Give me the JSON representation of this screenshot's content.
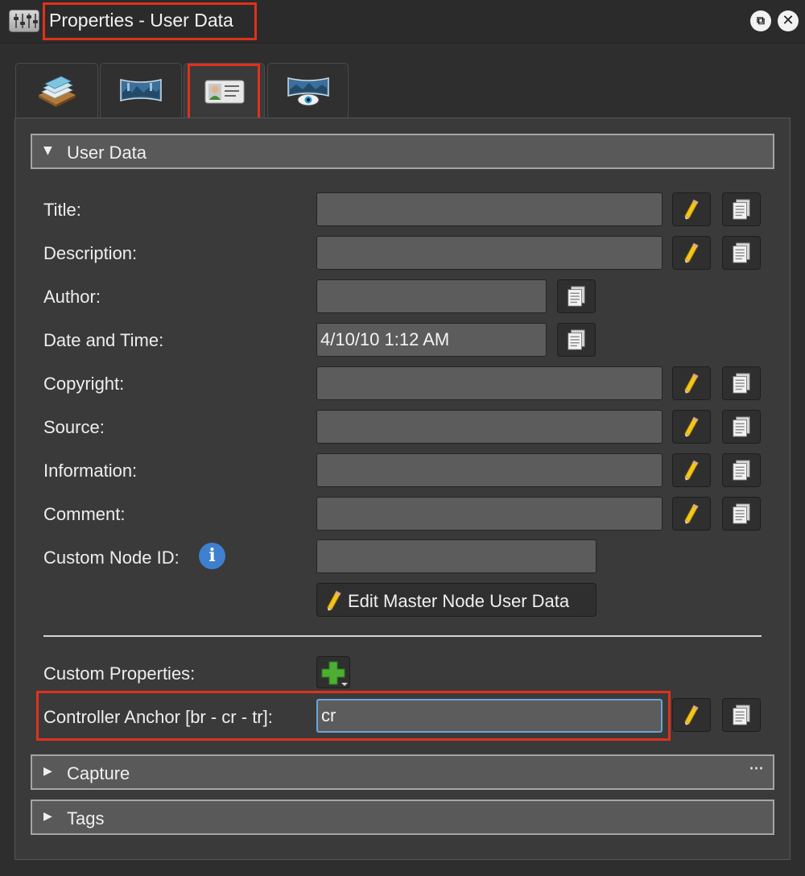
{
  "window": {
    "title": "Properties - User Data",
    "restore_icon": "restore-icon",
    "close_icon": "close-icon"
  },
  "tabs": [
    {
      "name": "layers-tab",
      "icon": "stacked-layers-icon",
      "active": false
    },
    {
      "name": "panorama-tab",
      "icon": "panorama-icon",
      "active": false
    },
    {
      "name": "user-data-tab",
      "icon": "id-card-icon",
      "active": true
    },
    {
      "name": "viewer-tab",
      "icon": "panorama-eye-icon",
      "active": false
    }
  ],
  "user_data": {
    "header": "User Data",
    "expanded": true,
    "fields": {
      "title": {
        "label": "Title:",
        "value": ""
      },
      "description": {
        "label": "Description:",
        "value": ""
      },
      "author": {
        "label": "Author:",
        "value": ""
      },
      "datetime": {
        "label": "Date and Time:",
        "value": "4/10/10 1:12 AM"
      },
      "copyright": {
        "label": "Copyright:",
        "value": ""
      },
      "source": {
        "label": "Source:",
        "value": ""
      },
      "information": {
        "label": "Information:",
        "value": ""
      },
      "comment": {
        "label": "Comment:",
        "value": ""
      },
      "custom_node_id": {
        "label": "Custom Node ID:",
        "value": ""
      }
    },
    "edit_master_label": "Edit Master Node User Data",
    "custom_properties_label": "Custom Properties:",
    "controller_anchor": {
      "label": "Controller Anchor [br - cr - tr]:",
      "value": "cr"
    }
  },
  "capture": {
    "header": "Capture",
    "expanded": false,
    "menu": "···"
  },
  "tags": {
    "header": "Tags",
    "expanded": false
  },
  "colors": {
    "highlight": "#e0311b",
    "focus": "#6aa4d8",
    "info": "#3f7fd0",
    "add": "#4caf32"
  }
}
